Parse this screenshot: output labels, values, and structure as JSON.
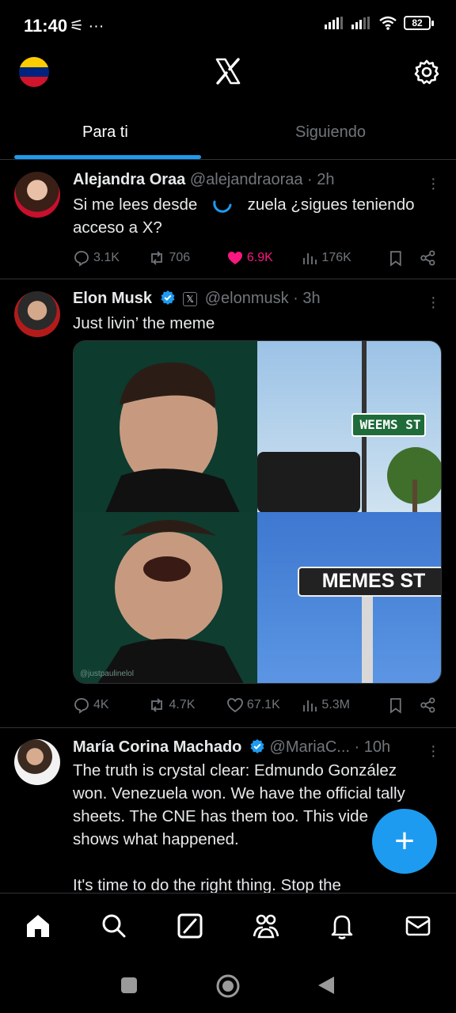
{
  "status_bar": {
    "time": "11:40",
    "left_icons": "⚟ ···",
    "battery": "82"
  },
  "tabs": [
    {
      "label": "Para ti"
    },
    {
      "label": "Siguiendo"
    }
  ],
  "tweets": [
    {
      "name": "Alejandra Oraa",
      "handle": "@alejandraoraa · 2h",
      "text_a": "Si me lees desde",
      "text_b": "zuela ¿sigues teniendo",
      "text_c": "acceso a X?",
      "replies": "3.1K",
      "reposts": "706",
      "likes": "6.9K",
      "views": "176K"
    },
    {
      "name": "Elon Musk",
      "handle": "@elonmusk · 3h",
      "text": "Just livin’ the meme",
      "sign_top": "WEEMS ST",
      "sign_bottom": "MEMES ST",
      "watermark": "@justpaulinelol",
      "replies": "4K",
      "reposts": "4.7K",
      "likes": "67.1K",
      "views": "5.3M"
    },
    {
      "name": "María Corina Machado",
      "handle": "@MariaC... · 10h",
      "lines": [
        "The truth is crystal clear: Edmundo González",
        "won. Venezuela won. We have the official tally",
        "sheets. The CNE has them too. This vide",
        "shows what happened.",
        "",
        "It's time to do the right thing. Stop the"
      ]
    }
  ],
  "fab": {
    "label": "+"
  },
  "colors": {
    "accent": "#1d9bf0",
    "like": "#f91880",
    "muted": "#71767b",
    "divider": "#2f3336"
  },
  "icons": [
    "x-logo-icon",
    "gear-icon",
    "reply-icon",
    "repost-icon",
    "like-icon",
    "views-icon",
    "bookmark-icon",
    "share-icon",
    "home-icon",
    "search-icon",
    "grok-icon",
    "communities-icon",
    "bell-icon",
    "mail-icon"
  ]
}
